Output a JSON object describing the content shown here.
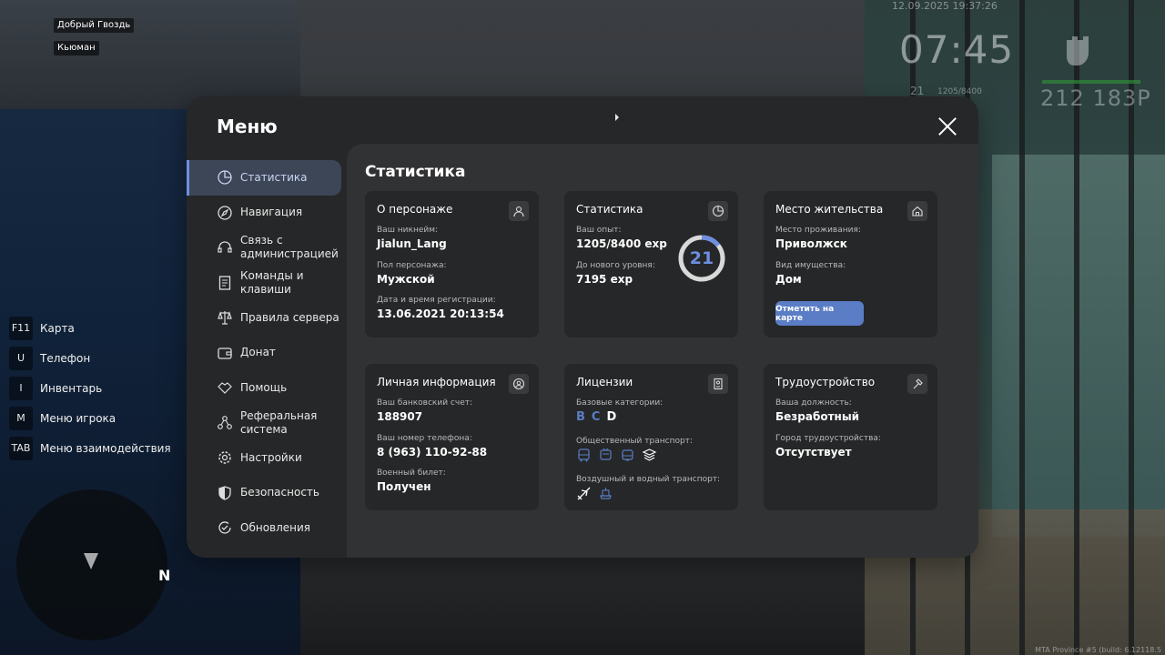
{
  "hud": {
    "nicknames": [
      "Добрый Гвоздь",
      "Кьюман"
    ],
    "datetime": "12.09.2025 19:37:26",
    "time": "07:45",
    "level": "21",
    "exp": "1205/8400",
    "money": "212 183Р"
  },
  "hotkeys": [
    {
      "key": "F11",
      "label": "Карта"
    },
    {
      "key": "U",
      "label": "Телефон"
    },
    {
      "key": "I",
      "label": "Инвентарь"
    },
    {
      "key": "M",
      "label": "Меню игрока"
    },
    {
      "key": "TAB",
      "label": "Меню взаимодействия"
    }
  ],
  "radar": {
    "north": "N"
  },
  "build": "MTA Province #5 (build: 6.12118.5",
  "menu": {
    "title": "Меню",
    "sidebar": [
      {
        "label": "Статистика",
        "icon": "pie-chart-icon",
        "active": true
      },
      {
        "label": "Навигация",
        "icon": "compass-icon"
      },
      {
        "label": "Связь с администрацией",
        "icon": "headset-icon"
      },
      {
        "label": "Команды и клавиши",
        "icon": "document-icon"
      },
      {
        "label": "Правила сервера",
        "icon": "scales-icon"
      },
      {
        "label": "Донат",
        "icon": "wallet-icon"
      },
      {
        "label": "Помощь",
        "icon": "handshake-icon"
      },
      {
        "label": "Реферальная система",
        "icon": "network-icon"
      },
      {
        "label": "Настройки",
        "icon": "gear-icon"
      },
      {
        "label": "Безопасность",
        "icon": "shield-icon"
      },
      {
        "label": "Обновления",
        "icon": "refresh-check-icon"
      }
    ],
    "content_title": "Статистика",
    "character": {
      "title": "О персонаже",
      "nickname_label": "Ваш никнейм:",
      "nickname": "Jialun_Lang",
      "gender_label": "Пол персонажа:",
      "gender": "Мужской",
      "reg_label": "Дата и время регистрации:",
      "reg": "13.06.2021 20:13:54"
    },
    "stats": {
      "title": "Статистика",
      "exp_label": "Ваш опыт:",
      "exp": "1205/8400 exp",
      "next_label": "До нового уровня:",
      "next": "7195 exp",
      "level": "21",
      "progress": 0.1435
    },
    "residence": {
      "title": "Место жительства",
      "place_label": "Место проживания:",
      "place": "Приволжск",
      "property_label": "Вид имущества:",
      "property": "Дом",
      "button": "Отметить на карте"
    },
    "personal": {
      "title": "Личная информация",
      "bank_label": "Ваш банковский счет:",
      "bank": "188907",
      "phone_label": "Ваш номер телефона:",
      "phone": "8 (963) 110-92-88",
      "military_label": "Военный билет:",
      "military": "Получен"
    },
    "licenses": {
      "title": "Лицензии",
      "base_label": "Базовые категории:",
      "categories": [
        "B",
        "C",
        "D"
      ],
      "public_label": "Общественный транспорт:",
      "air_label": "Воздушный и водный транспорт:"
    },
    "employment": {
      "title": "Трудоустройство",
      "position_label": "Ваша должность:",
      "position": "Безработный",
      "city_label": "Город трудоустройства:",
      "city": "Отсутствует"
    }
  },
  "colors": {
    "accent": "#6d8fe0",
    "button": "#5b7dc6",
    "panel": "#262728",
    "content": "#313233"
  }
}
